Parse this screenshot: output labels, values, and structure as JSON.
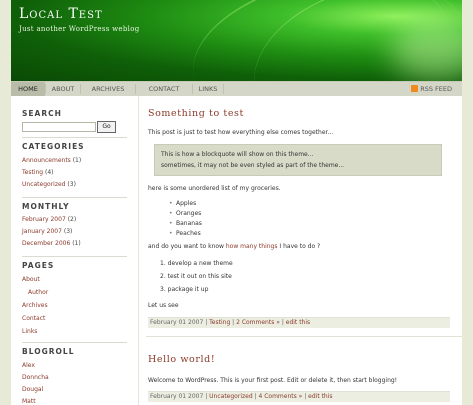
{
  "header": {
    "title": "Local Test",
    "tagline": "Just another WordPress weblog"
  },
  "nav": {
    "items": [
      "HOME",
      "ABOUT",
      "ARCHIVES",
      "CONTACT",
      "LINKS"
    ],
    "active": "HOME",
    "rss_label": "RSS FEED"
  },
  "sidebar": {
    "search": {
      "heading": "SEARCH",
      "button": "Go",
      "value": ""
    },
    "categories": {
      "heading": "CATEGORIES",
      "items": [
        {
          "label": "Announcements",
          "count": "(1)"
        },
        {
          "label": "Testing",
          "count": "(4)"
        },
        {
          "label": "Uncategorized",
          "count": "(3)"
        }
      ]
    },
    "monthly": {
      "heading": "MONTHLY",
      "items": [
        {
          "label": "February 2007",
          "count": "(2)"
        },
        {
          "label": "January 2007",
          "count": "(3)"
        },
        {
          "label": "December 2006",
          "count": "(1)"
        }
      ]
    },
    "pages": {
      "heading": "PAGES",
      "items": [
        "About",
        "Author",
        "Archives",
        "Contact",
        "Links"
      ]
    },
    "blogroll": {
      "heading": "BLOGROLL",
      "items": [
        "Alex",
        "Donncha",
        "Dougal",
        "Matt"
      ]
    }
  },
  "posts": [
    {
      "title": "Something to test",
      "intro": "This post is just to test how everything else comes together...",
      "quote_line1": "This is how a blockquote will show on this theme...",
      "quote_line2": "sometimes, it may not be even styled as part of the theme...",
      "list_intro": "here is some unordered list of my groceries.",
      "ul": [
        "Apples",
        "Oranges",
        "Bananas",
        "Peaches"
      ],
      "ol_intro_before": "and do you want to know ",
      "ol_intro_link": "how many things",
      "ol_intro_after": " I have to do ?",
      "ol": [
        "1.   develop a new theme",
        "2.   test it out on this site",
        "3.   package it up"
      ],
      "outro": "Let us see",
      "meta_date": "February 01 2007 | ",
      "meta_category": "Testing",
      "meta_sep": " | ",
      "meta_comments": "2 Comments »",
      "meta_sep2": " | ",
      "meta_edit": "edit this"
    },
    {
      "title": "Hello world!",
      "body": "Welcome to WordPress. This is your first post. Edit or delete it, then start blogging!",
      "meta_date": "February 01 2007 | ",
      "meta_category": "Uncategorized",
      "meta_sep": " | ",
      "meta_comments": "4 Comments »",
      "meta_sep2": " | ",
      "meta_edit": "edit this"
    }
  ],
  "colors": {
    "link": "#8a3a2a",
    "header_green": "#1e8c12",
    "nav_bg": "#d4d7c8",
    "page_bg": "#e8ead8"
  }
}
